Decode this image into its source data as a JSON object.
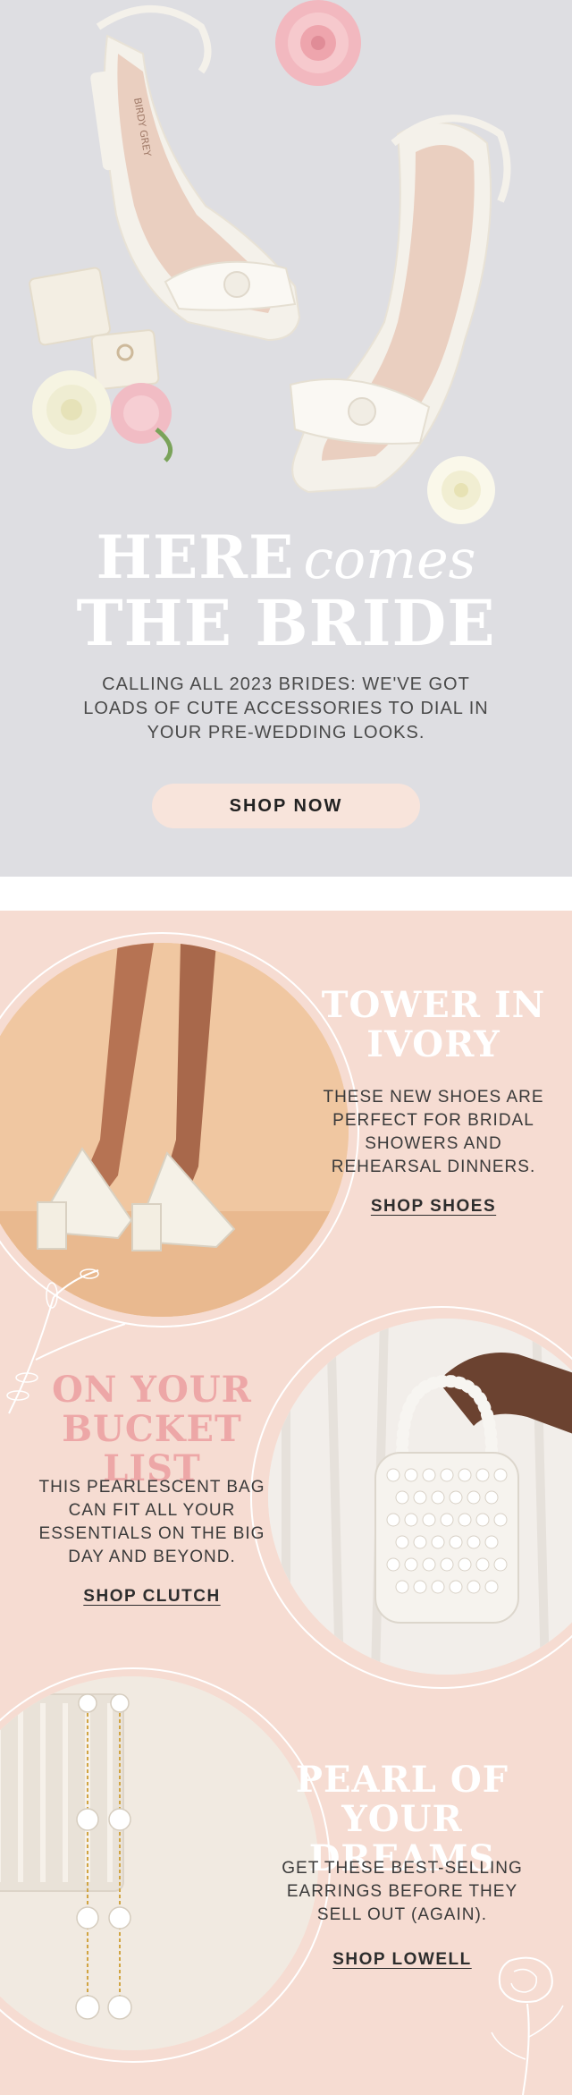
{
  "hero": {
    "headline_here": "HERE",
    "headline_comes": "comes",
    "headline_bride": "THE BRIDE",
    "subtext": "CALLING ALL 2023 BRIDES: WE'VE GOT LOADS OF CUTE ACCESSORIES TO DIAL IN YOUR PRE-WEDDING LOOKS.",
    "cta": "SHOP NOW",
    "shoe_brand": "BIRDY GREY"
  },
  "features": [
    {
      "title_line1": "TOWER IN",
      "title_line2": "IVORY",
      "body": "THESE NEW SHOES ARE PERFECT FOR BRIDAL SHOWERS AND REHEARSAL DINNERS.",
      "link": "SHOP SHOES"
    },
    {
      "title_line1": "ON YOUR",
      "title_line2": "BUCKET LIST",
      "body": "THIS PEARLESCENT BAG CAN FIT ALL YOUR ESSENTIALS ON THE BIG DAY AND BEYOND.",
      "link": "SHOP CLUTCH"
    },
    {
      "title_line1": "PEARL OF",
      "title_line2": "YOUR DREAMS",
      "body": "GET THESE BEST-SELLING EARRINGS BEFORE THEY SELL OUT (AGAIN).",
      "link": "SHOP LOWELL"
    }
  ],
  "colors": {
    "hero_bg": "#dedee2",
    "feature_bg": "#f6dcd2",
    "accent_pink": "#eda7a7",
    "button_bg": "#f8e4db"
  }
}
